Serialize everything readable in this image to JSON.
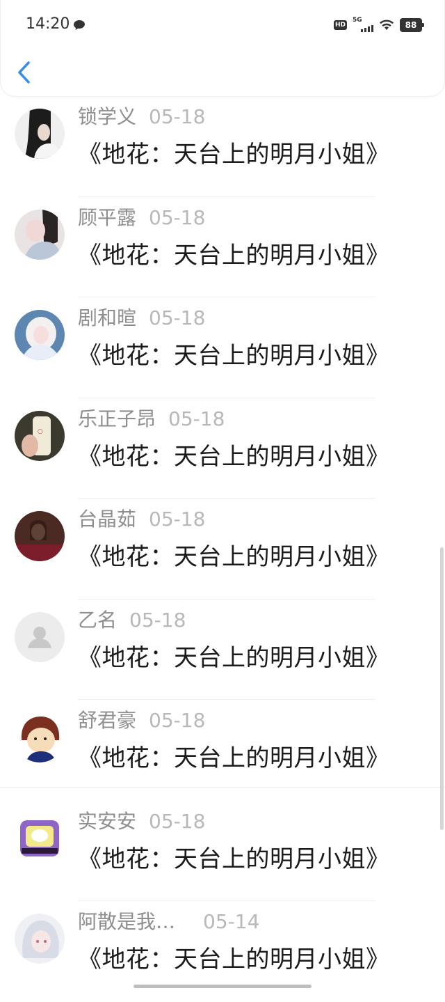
{
  "status_bar": {
    "time": "14:20",
    "icons": [
      "chat-bubble-icon",
      "hd-icon",
      "5g-signal-icon",
      "wifi-icon",
      "battery-icon"
    ],
    "hd": "HD",
    "network": "5G",
    "battery": "88"
  },
  "header": {
    "back_icon": "chevron-left-icon",
    "accent": "#3a8ee6"
  },
  "messages": [
    {
      "name": "锁学义",
      "date": "05-18",
      "text": "《地花：天台上的明月小姐》"
    },
    {
      "name": "顾平露",
      "date": "05-18",
      "text": "《地花：天台上的明月小姐》"
    },
    {
      "name": "剧和暄",
      "date": "05-18",
      "text": "《地花：天台上的明月小姐》"
    },
    {
      "name": "乐正子昂",
      "date": "05-18",
      "text": "《地花：天台上的明月小姐》"
    },
    {
      "name": "台晶茹",
      "date": "05-18",
      "text": "《地花：天台上的明月小姐》"
    },
    {
      "name": "乙名",
      "date": "05-18",
      "text": "《地花：天台上的明月小姐》"
    },
    {
      "name": "舒君豪",
      "date": "05-18",
      "text": "《地花：天台上的明月小姐》"
    },
    {
      "name": "实安安",
      "date": "05-18",
      "text": "《地花：天台上的明月小姐》"
    },
    {
      "name": "阿散是我…",
      "date": "05-14",
      "text": "《地花：天台上的明月小姐》"
    }
  ]
}
